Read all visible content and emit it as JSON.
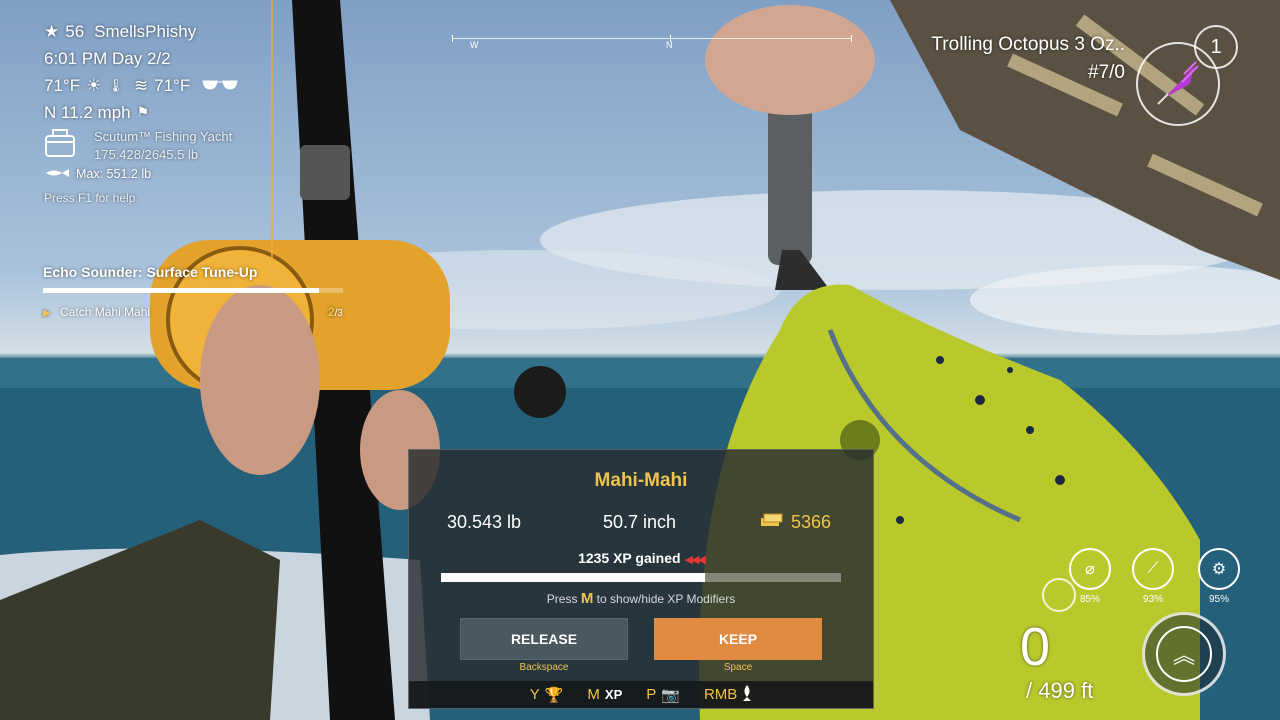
{
  "player": {
    "level": "56",
    "name": "SmellsPhishy",
    "time": "6:01 PM Day 2/2",
    "air_temp": "71°F",
    "water_temp": "71°F",
    "wind": "N 11.2 mph",
    "boat_name": "Scutum™ Fishing Yacht",
    "boat_load": "175.428/2645.5 lb",
    "max_weight": "Max: 551.2 lb",
    "help_hint": "Press F1 for help"
  },
  "quest": {
    "title": "Echo Sounder: Surface Tune-Up",
    "progress": 0.92,
    "task": "Catch Mahi Mahi",
    "count_current": "2",
    "count_total": "/3"
  },
  "compass": {
    "west_label": "W",
    "north_label": "N"
  },
  "lure": {
    "name": "Trolling Octopus 3 Oz..",
    "count": "#7/0",
    "rod_number": "1",
    "accent_color": "#b63ad1"
  },
  "tackle": {
    "line_pct": "85%",
    "rod_pct": "93%",
    "reel_pct": "95%"
  },
  "depth": {
    "current": "0",
    "max": "/ 499 ft"
  },
  "catch_panel": {
    "fish_name": "Mahi-Mahi",
    "weight": "30.543 lb",
    "length": "50.7 inch",
    "price": "5366",
    "xp_text": "1235 XP gained",
    "xp_progress": 0.66,
    "hint_prefix": "Press",
    "hint_key": "M",
    "hint_suffix": "to show/hide XP Modifiers",
    "release_label": "RELEASE",
    "release_key": "Backspace",
    "keep_label": "KEEP",
    "keep_key": "Space",
    "footer": {
      "y_key": "Y",
      "m_key": "M",
      "m_label": "XP",
      "p_key": "P",
      "rmb_key": "RMB"
    }
  },
  "colors": {
    "accent_gold": "#f0c34d",
    "keep_orange": "#e08a42",
    "release_gray": "#4a5860"
  }
}
